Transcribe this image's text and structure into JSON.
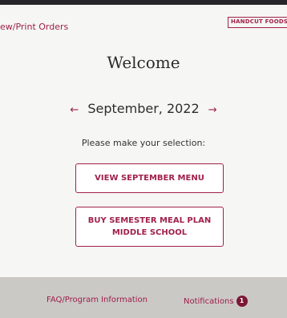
{
  "header": {
    "nav_link": "ew/Print Orders",
    "brand": "HANDCUT FOODS"
  },
  "main": {
    "welcome": "Welcome",
    "month": "September, 2022",
    "prev_arrow": "←",
    "next_arrow": "→",
    "prompt": "Please make your selection:",
    "buttons": {
      "view_menu": "VIEW SEPTEMBER MENU",
      "buy_plan_line1": "BUY SEMESTER MEAL PLAN",
      "buy_plan_line2": "MIDDLE SCHOOL"
    }
  },
  "footer": {
    "faq": "FAQ/Program Information",
    "notifications": "Notifications",
    "notification_count": "1"
  },
  "colors": {
    "accent": "#a0214b",
    "footer_bg": "#cbc9c6",
    "page_bg": "#f6f6f4"
  }
}
